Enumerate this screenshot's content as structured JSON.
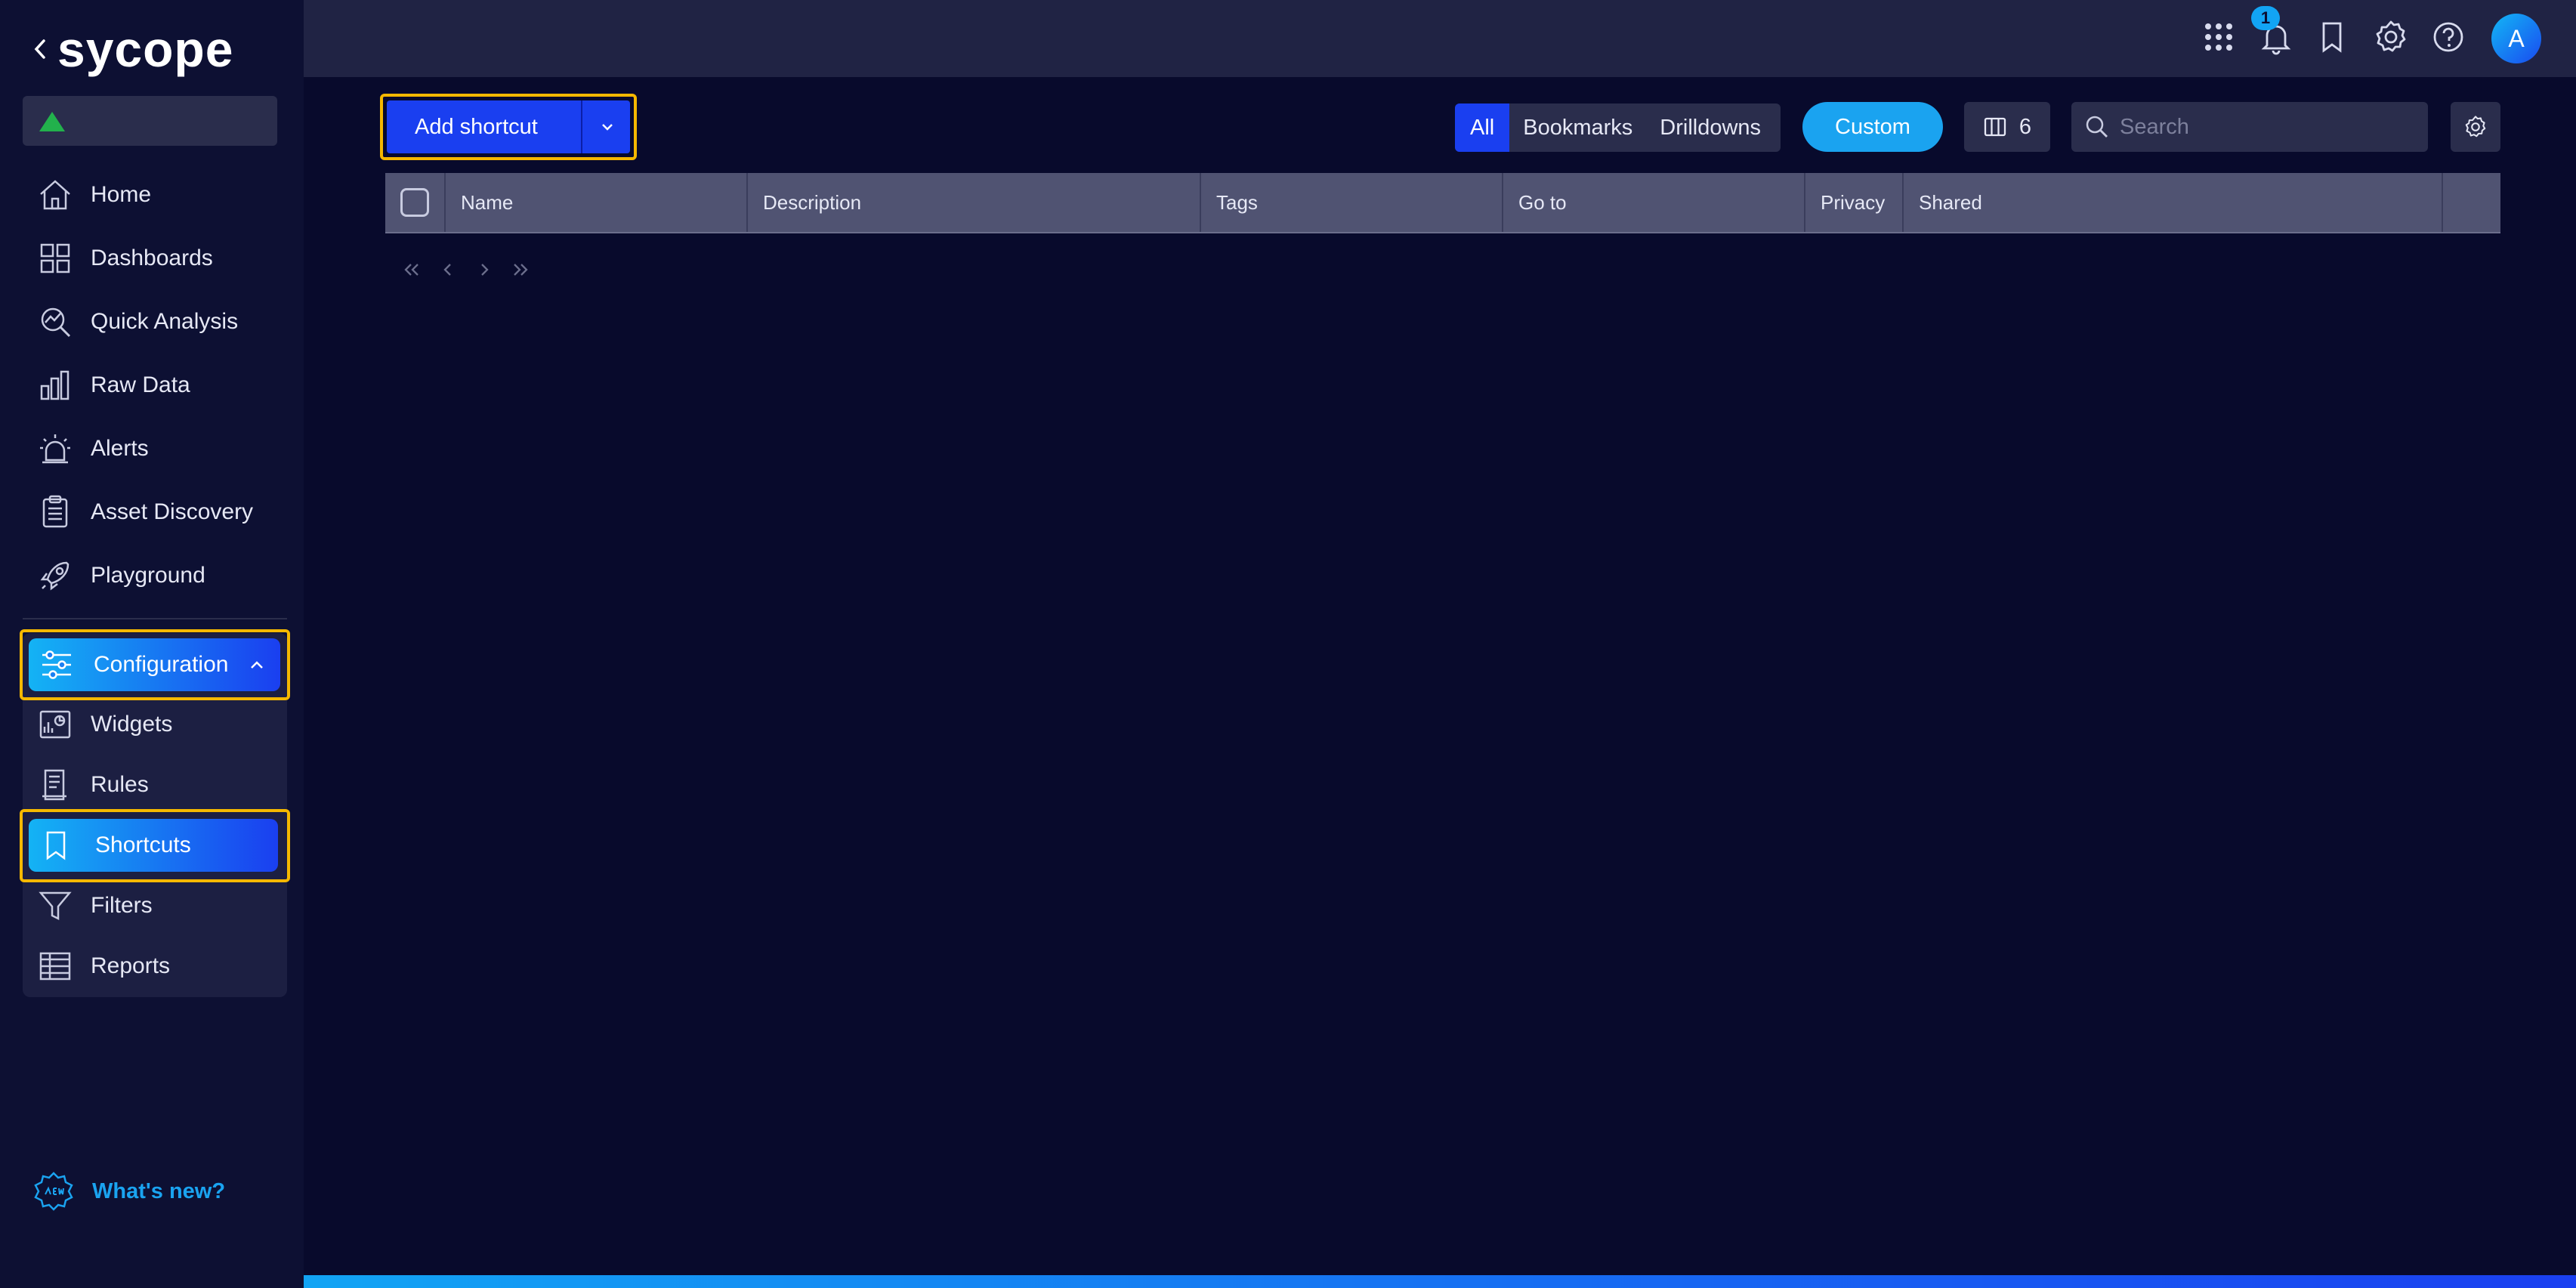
{
  "app": {
    "logo_text": "sycope",
    "accent": "#1a3ff0",
    "accent_light": "#14b3f4",
    "highlight": "#f5b800"
  },
  "sidebar": {
    "items": [
      {
        "label": "Home",
        "icon": "home-icon"
      },
      {
        "label": "Dashboards",
        "icon": "dashboard-icon"
      },
      {
        "label": "Quick Analysis",
        "icon": "quick-analysis-icon"
      },
      {
        "label": "Raw Data",
        "icon": "bar-chart-icon"
      },
      {
        "label": "Alerts",
        "icon": "alarm-icon"
      },
      {
        "label": "Asset Discovery",
        "icon": "clipboard-icon"
      },
      {
        "label": "Playground",
        "icon": "rocket-icon"
      }
    ],
    "config": {
      "label": "Configuration",
      "icon": "sliders-icon",
      "expanded": true,
      "children": [
        {
          "label": "Widgets",
          "icon": "widget-icon"
        },
        {
          "label": "Rules",
          "icon": "rules-icon"
        },
        {
          "label": "Shortcuts",
          "icon": "bookmark-icon",
          "active": true
        },
        {
          "label": "Filters",
          "icon": "funnel-icon"
        },
        {
          "label": "Reports",
          "icon": "table-icon"
        }
      ]
    },
    "whats_new": {
      "label": "What's new?",
      "icon": "new-badge-icon"
    }
  },
  "topbar": {
    "notification_count": "1",
    "avatar_initial": "A"
  },
  "toolbar": {
    "add_label": "Add shortcut",
    "filter_options": [
      "All",
      "Bookmarks",
      "Drilldowns"
    ],
    "active_filter": "All",
    "custom_label": "Custom",
    "columns_count": "6",
    "search_placeholder": "Search"
  },
  "table": {
    "columns": [
      "Name",
      "Description",
      "Tags",
      "Go to",
      "Privacy",
      "Shared"
    ],
    "rows": []
  },
  "colors": {
    "sensor_status": "#22b14c"
  }
}
